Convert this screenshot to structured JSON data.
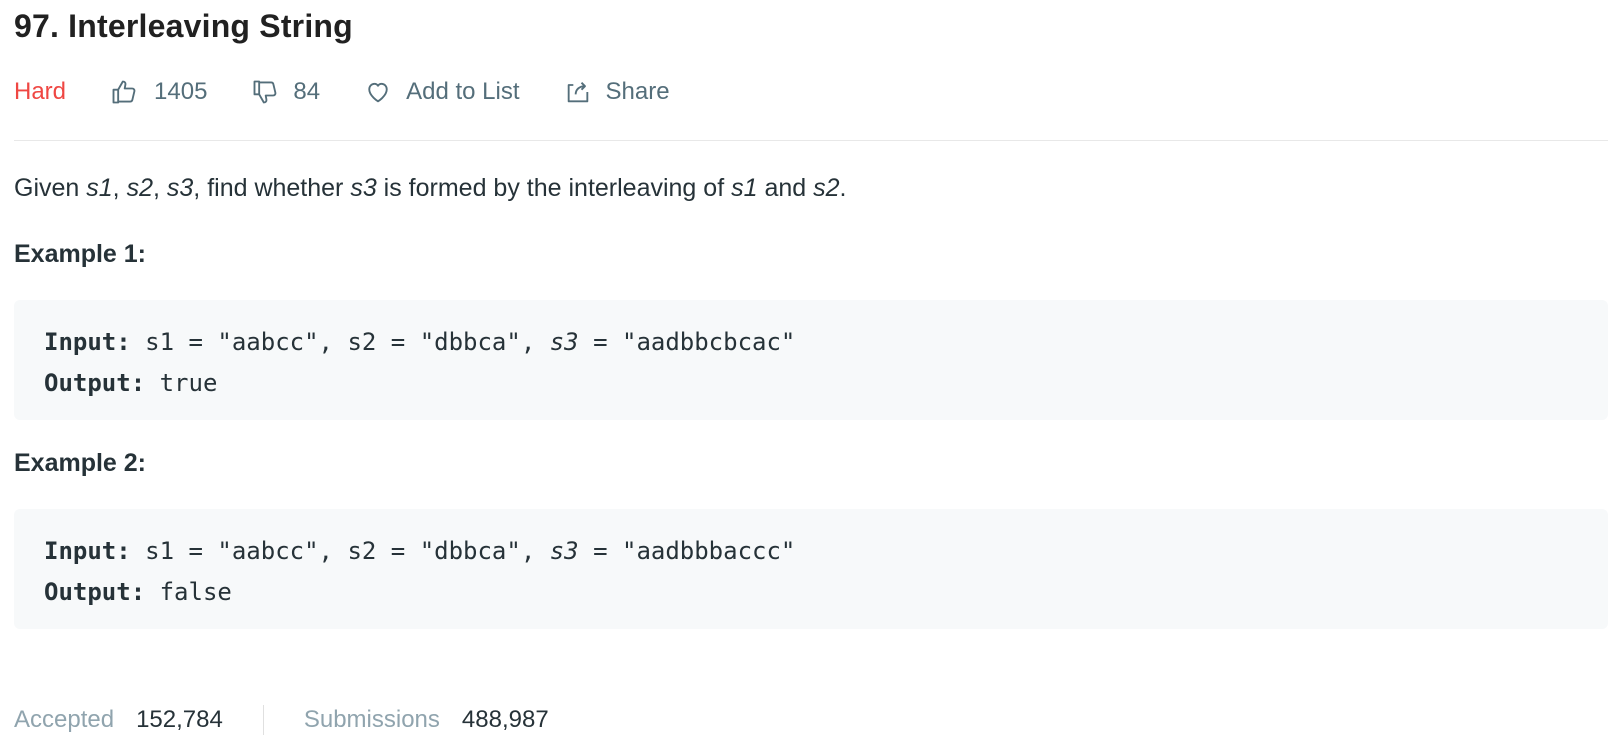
{
  "problem": {
    "title": "97. Interleaving String",
    "difficulty": "Hard",
    "likes": "1405",
    "dislikes": "84",
    "add_to_list": "Add to List",
    "share": "Share",
    "description": {
      "pre": "Given ",
      "v1": "s1",
      "c1": ", ",
      "v2": "s2",
      "c2": ", ",
      "v3": "s3",
      "mid": ", find whether ",
      "v4": "s3",
      "mid2": " is formed by the interleaving of ",
      "v5": "s1",
      "and": " and ",
      "v6": "s2",
      "end": "."
    },
    "examples": [
      {
        "title": "Example 1:",
        "input_label": "Input:",
        "input_a": " s1 = \"aabcc\", s2 = \"dbbca\", ",
        "input_var": "s3",
        "input_b": " = \"aadbbcbcac\"",
        "output_label": "Output:",
        "output_value": " true"
      },
      {
        "title": "Example 2:",
        "input_label": "Input:",
        "input_a": " s1 = \"aabcc\", s2 = \"dbbca\", ",
        "input_var": "s3",
        "input_b": " = \"aadbbbaccc\"",
        "output_label": "Output:",
        "output_value": " false"
      }
    ],
    "stats": {
      "accepted_label": "Accepted",
      "accepted_value": "152,784",
      "submissions_label": "Submissions",
      "submissions_value": "488,987"
    }
  },
  "colors": {
    "difficulty_hard": "#ef4743",
    "meta_text": "#546e7a",
    "code_bg": "#f7f9fa"
  },
  "icons": [
    "thumbs-up-icon",
    "thumbs-down-icon",
    "heart-icon",
    "share-icon"
  ]
}
